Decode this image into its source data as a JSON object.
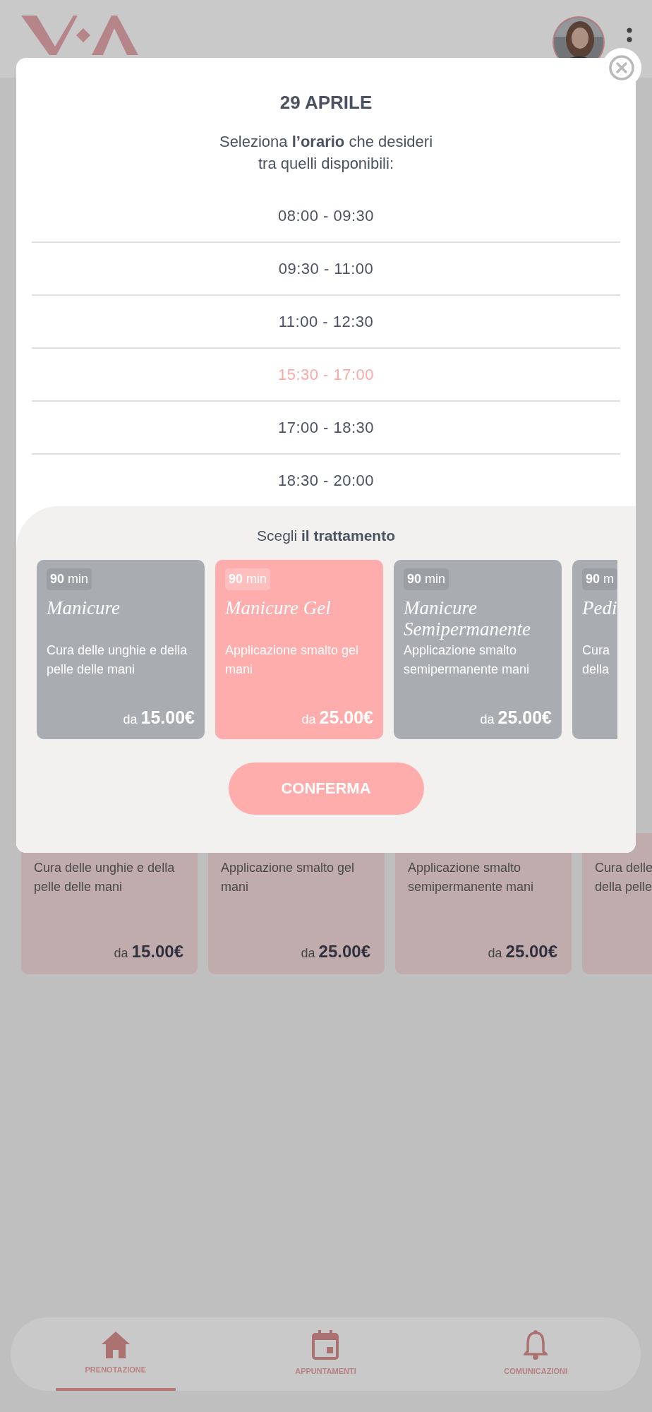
{
  "background_cards": [
    {
      "description": "Cura delle unghie e della pelle delle mani",
      "price_prefix": "da",
      "price": "15.00€"
    },
    {
      "description": "Applicazione smalto gel mani",
      "price_prefix": "da",
      "price": "25.00€"
    },
    {
      "description": "Applicazione smalto semipermanente mani",
      "price_prefix": "da",
      "price": "25.00€"
    },
    {
      "description": "Cura delle della pelle"
    }
  ],
  "modal": {
    "title": "29 APRILE",
    "subtitle": "Seleziona **l’orario** che desideri tra quelli disponibili:",
    "time_slots": [
      {
        "label": "08:00 - 09:30",
        "selected": false
      },
      {
        "label": "09:30 - 11:00",
        "selected": false
      },
      {
        "label": "11:00 - 12:30",
        "selected": false
      },
      {
        "label": "15:30 - 17:00",
        "selected": true
      },
      {
        "label": "17:00 - 18:30",
        "selected": false
      },
      {
        "label": "18:30 - 20:00",
        "selected": false
      }
    ],
    "treatment_heading": "Scegli **il trattamento**",
    "treatments": [
      {
        "duration": "90",
        "unit": "min",
        "name": "Manicure",
        "description": "Cura delle unghie e della pelle delle mani",
        "price_prefix": "da",
        "price": "15.00€",
        "selected": false
      },
      {
        "duration": "90",
        "unit": "min",
        "name": "Manicure Gel",
        "description": "Applicazione smalto gel mani",
        "price_prefix": "da",
        "price": "25.00€",
        "selected": true
      },
      {
        "duration": "90",
        "unit": "min",
        "name": "Manicure Semipermanente",
        "description": "Applicazione smalto semipermanente mani",
        "price_prefix": "da",
        "price": "25.00€",
        "selected": false
      },
      {
        "duration": "90",
        "unit": "m",
        "name": "Pedi",
        "description": "Cura della",
        "selected": false
      }
    ],
    "confirm_button": "CONFERMA"
  },
  "bottom_nav": [
    {
      "label": "PRENOTAZIONE",
      "selected": true
    },
    {
      "label": "APPUNTAMENTI",
      "selected": false
    },
    {
      "label": "COMUNICAZIONI",
      "selected": false
    }
  ]
}
